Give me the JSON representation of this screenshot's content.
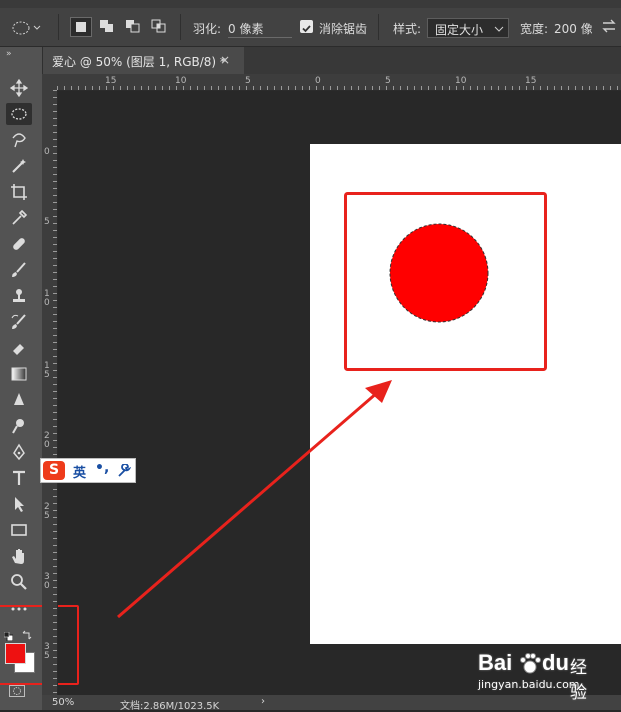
{
  "options_bar": {
    "feather_label": "羽化:",
    "feather_value": "0 像素",
    "antialias_label": "消除锯齿",
    "style_label": "样式:",
    "style_value": "固定大小",
    "width_label": "宽度:",
    "width_value": "200 像"
  },
  "document_tab": {
    "title": "爱心 @ 50% (图层 1, RGB/8) *",
    "close": "×"
  },
  "ruler_top": [
    "15",
    "10",
    "5",
    "0",
    "5",
    "10",
    "15"
  ],
  "ruler_left": [
    "0",
    "5",
    "1\n0",
    "1\n5",
    "2\n0",
    "2\n5",
    "3\n0",
    "3\n5"
  ],
  "status": {
    "zoom": "50%",
    "doc_info": "文档:2.86M/1023.5K"
  },
  "ime": {
    "label": "英",
    "punct": "•,"
  },
  "watermark": {
    "brand": "Bai",
    "brand2": "du",
    "product": "经验",
    "url": "jingyan.baidu.com"
  },
  "colors": {
    "foreground": "#ee1111",
    "background": "#ffffff",
    "annotation": "#e8221c",
    "circle": "#ff0000"
  }
}
